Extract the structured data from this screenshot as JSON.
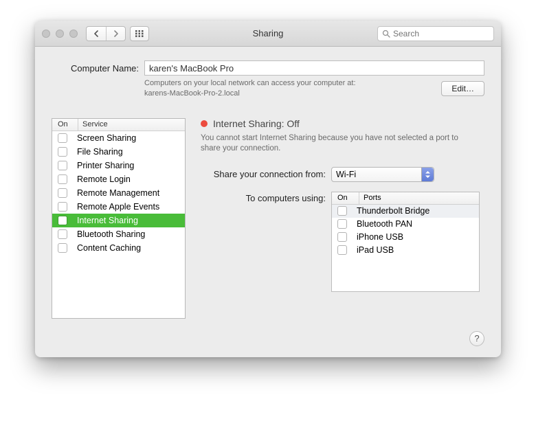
{
  "window": {
    "title": "Sharing"
  },
  "search": {
    "placeholder": "Search"
  },
  "computer_name": {
    "label": "Computer Name:",
    "value": "karen's MacBook Pro",
    "hint_line1": "Computers on your local network can access your computer at:",
    "hint_line2": "karens-MacBook-Pro-2.local",
    "edit_label": "Edit…"
  },
  "services_header": {
    "on": "On",
    "service": "Service"
  },
  "services": [
    {
      "label": "Screen Sharing",
      "selected": false
    },
    {
      "label": "File Sharing",
      "selected": false
    },
    {
      "label": "Printer Sharing",
      "selected": false
    },
    {
      "label": "Remote Login",
      "selected": false
    },
    {
      "label": "Remote Management",
      "selected": false
    },
    {
      "label": "Remote Apple Events",
      "selected": false
    },
    {
      "label": "Internet Sharing",
      "selected": true
    },
    {
      "label": "Bluetooth Sharing",
      "selected": false
    },
    {
      "label": "Content Caching",
      "selected": false
    }
  ],
  "detail": {
    "status_title": "Internet Sharing: Off",
    "status_color": "#ec4b3e",
    "warning": "You cannot start Internet Sharing because you have not selected a port to share your connection.",
    "share_from_label": "Share your connection from:",
    "share_from_value": "Wi-Fi",
    "to_computers_label": "To computers using:",
    "ports_header": {
      "on": "On",
      "ports": "Ports"
    },
    "ports": [
      {
        "label": "Thunderbolt Bridge",
        "highlight": true
      },
      {
        "label": "Bluetooth PAN",
        "highlight": false
      },
      {
        "label": "iPhone USB",
        "highlight": false
      },
      {
        "label": "iPad USB",
        "highlight": false
      }
    ]
  },
  "help_label": "?"
}
